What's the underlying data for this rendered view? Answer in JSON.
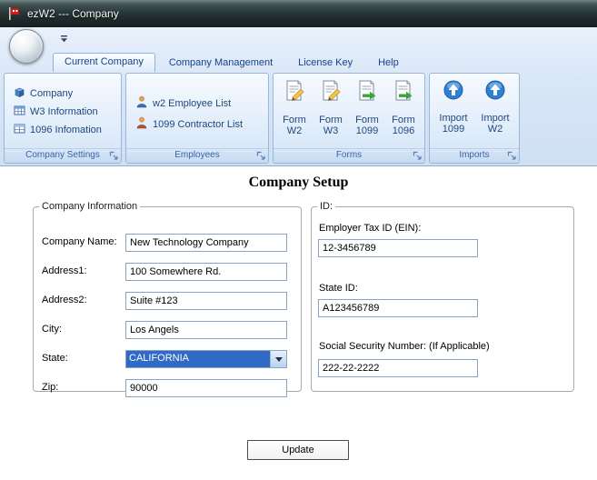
{
  "window": {
    "title": "ezW2 --- Company"
  },
  "ribbon": {
    "tabs": [
      {
        "label": "Current Company"
      },
      {
        "label": "Company Management"
      },
      {
        "label": "License Key"
      },
      {
        "label": "Help"
      }
    ],
    "groups": {
      "company_settings": {
        "label": "Company Settings",
        "items": [
          {
            "label": "Company"
          },
          {
            "label": "W3 Information"
          },
          {
            "label": "1096 Infomation"
          }
        ]
      },
      "employees": {
        "label": "Employees",
        "items": [
          {
            "label": "w2 Employee List"
          },
          {
            "label": "1099 Contractor List"
          }
        ]
      },
      "forms": {
        "label": "Forms",
        "items": [
          {
            "top": "Form",
            "bottom": "W2"
          },
          {
            "top": "Form",
            "bottom": "W3"
          },
          {
            "top": "Form",
            "bottom": "1099"
          },
          {
            "top": "Form",
            "bottom": "1096"
          }
        ]
      },
      "imports": {
        "label": "Imports",
        "items": [
          {
            "top": "Import",
            "bottom": "1099"
          },
          {
            "top": "Import",
            "bottom": "W2"
          }
        ]
      }
    }
  },
  "main": {
    "title": "Company Setup",
    "company_info": {
      "legend": "Company Information",
      "fields": [
        {
          "label": "Company Name:",
          "value": "New Technology Company"
        },
        {
          "label": "Address1:",
          "value": "100 Somewhere Rd."
        },
        {
          "label": "Address2:",
          "value": "Suite #123"
        },
        {
          "label": "City:",
          "value": "Los Angels"
        },
        {
          "label": "State:",
          "value": "CALIFORNIA"
        },
        {
          "label": "Zip:",
          "value": "90000"
        }
      ]
    },
    "ids": {
      "legend": "ID:",
      "fields": [
        {
          "label": "Employer Tax ID (EIN):",
          "value": "12-3456789"
        },
        {
          "label": "State ID:",
          "value": "A123456789"
        },
        {
          "label": "Social Security Number: (If Applicable)",
          "value": "222-22-2222"
        }
      ]
    },
    "update_button": "Update"
  },
  "colors": {
    "tab_text": "#15428b",
    "selection_highlight": "#316ac5",
    "titlebar_dark": "#273435",
    "ribbon_blue": "#d8e6f7"
  }
}
